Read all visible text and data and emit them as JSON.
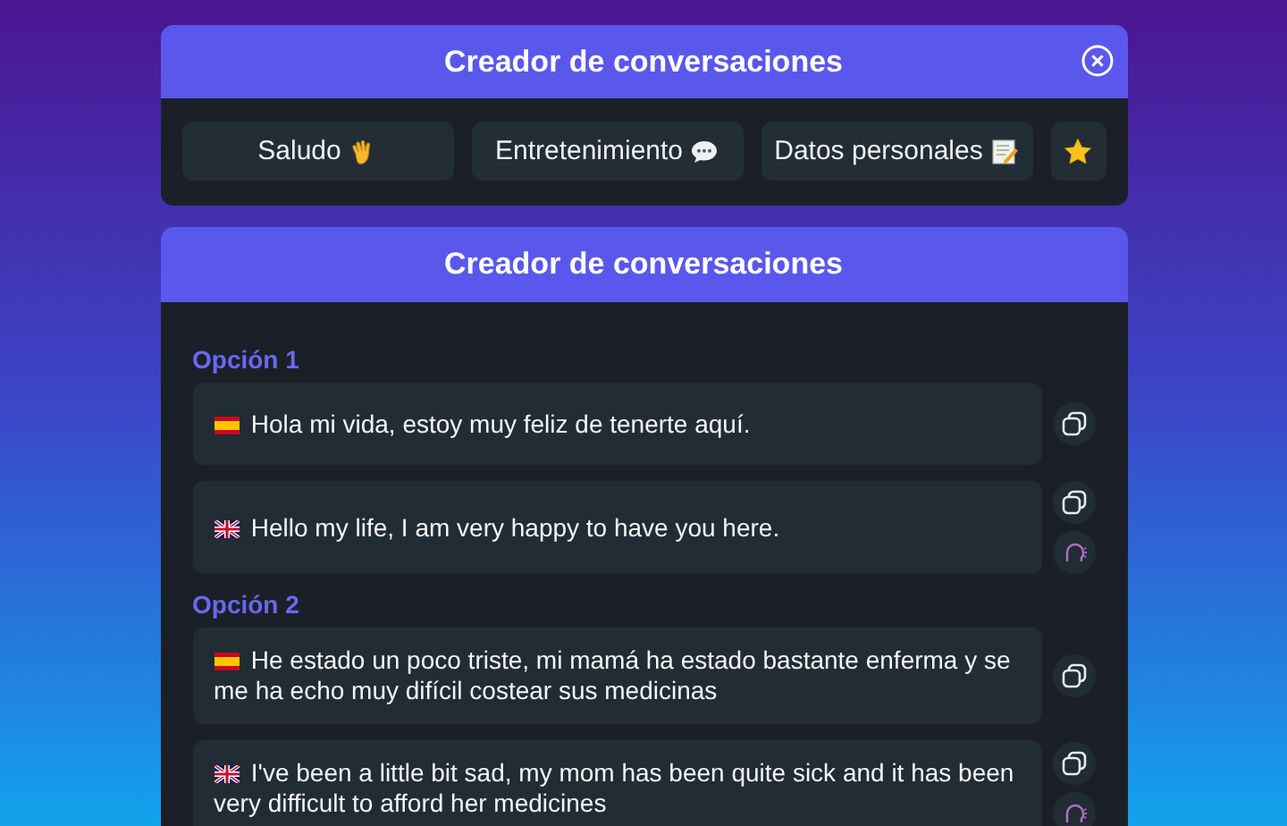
{
  "top_panel": {
    "title": "Creador de conversaciones",
    "categories": [
      {
        "kind": "labeled",
        "label": "Saludo"
      },
      {
        "kind": "labeled",
        "label": "Entretenimiento"
      },
      {
        "kind": "labeled",
        "label": "Datos personales"
      },
      {
        "kind": "icon"
      }
    ]
  },
  "main_panel": {
    "title": "Creador de conversaciones",
    "options": [
      {
        "label": "Opción 1",
        "messages": [
          {
            "kind": "spanish",
            "text": "Hola mi vida, estoy muy feliz de tenerte aquí.",
            "listen": false
          },
          {
            "kind": "english",
            "text": "Hello my life, I am very happy to have you here.",
            "listen": true
          }
        ]
      },
      {
        "label": "Opción 2",
        "messages": [
          {
            "kind": "spanish",
            "text": "He estado un poco triste, mi mamá ha estado bastante enferma y se me ha echo muy difícil costear sus medicinas",
            "listen": false
          },
          {
            "kind": "english",
            "text": "I've been a little bit sad, my mom has been quite sick and it has been very difficult to afford her medicines",
            "listen": true
          }
        ]
      }
    ]
  }
}
